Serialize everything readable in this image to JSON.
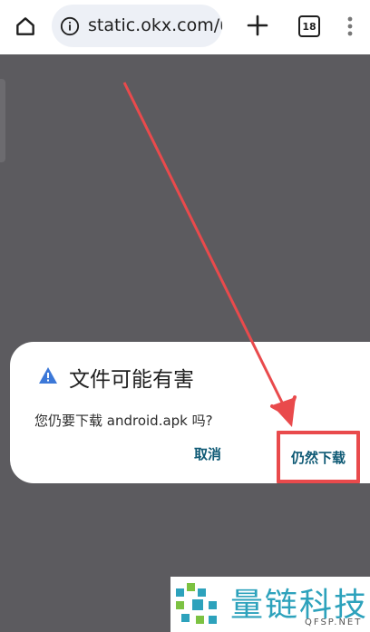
{
  "browser": {
    "url": "static.okx.com/u",
    "tab_count": "18"
  },
  "dialog": {
    "title": "文件可能有害",
    "message": "您仍要下载 android.apk 吗?",
    "cancel_label": "取消",
    "download_label": "仍然下载"
  },
  "watermark": {
    "brand": "量链科技",
    "domain": "QFSP.NET"
  },
  "colors": {
    "overlay": "#5c5b5f",
    "action": "#0f5a75",
    "annotation": "#e94a4c",
    "warning": "#3c78d8",
    "brand": "#2da2bc"
  }
}
